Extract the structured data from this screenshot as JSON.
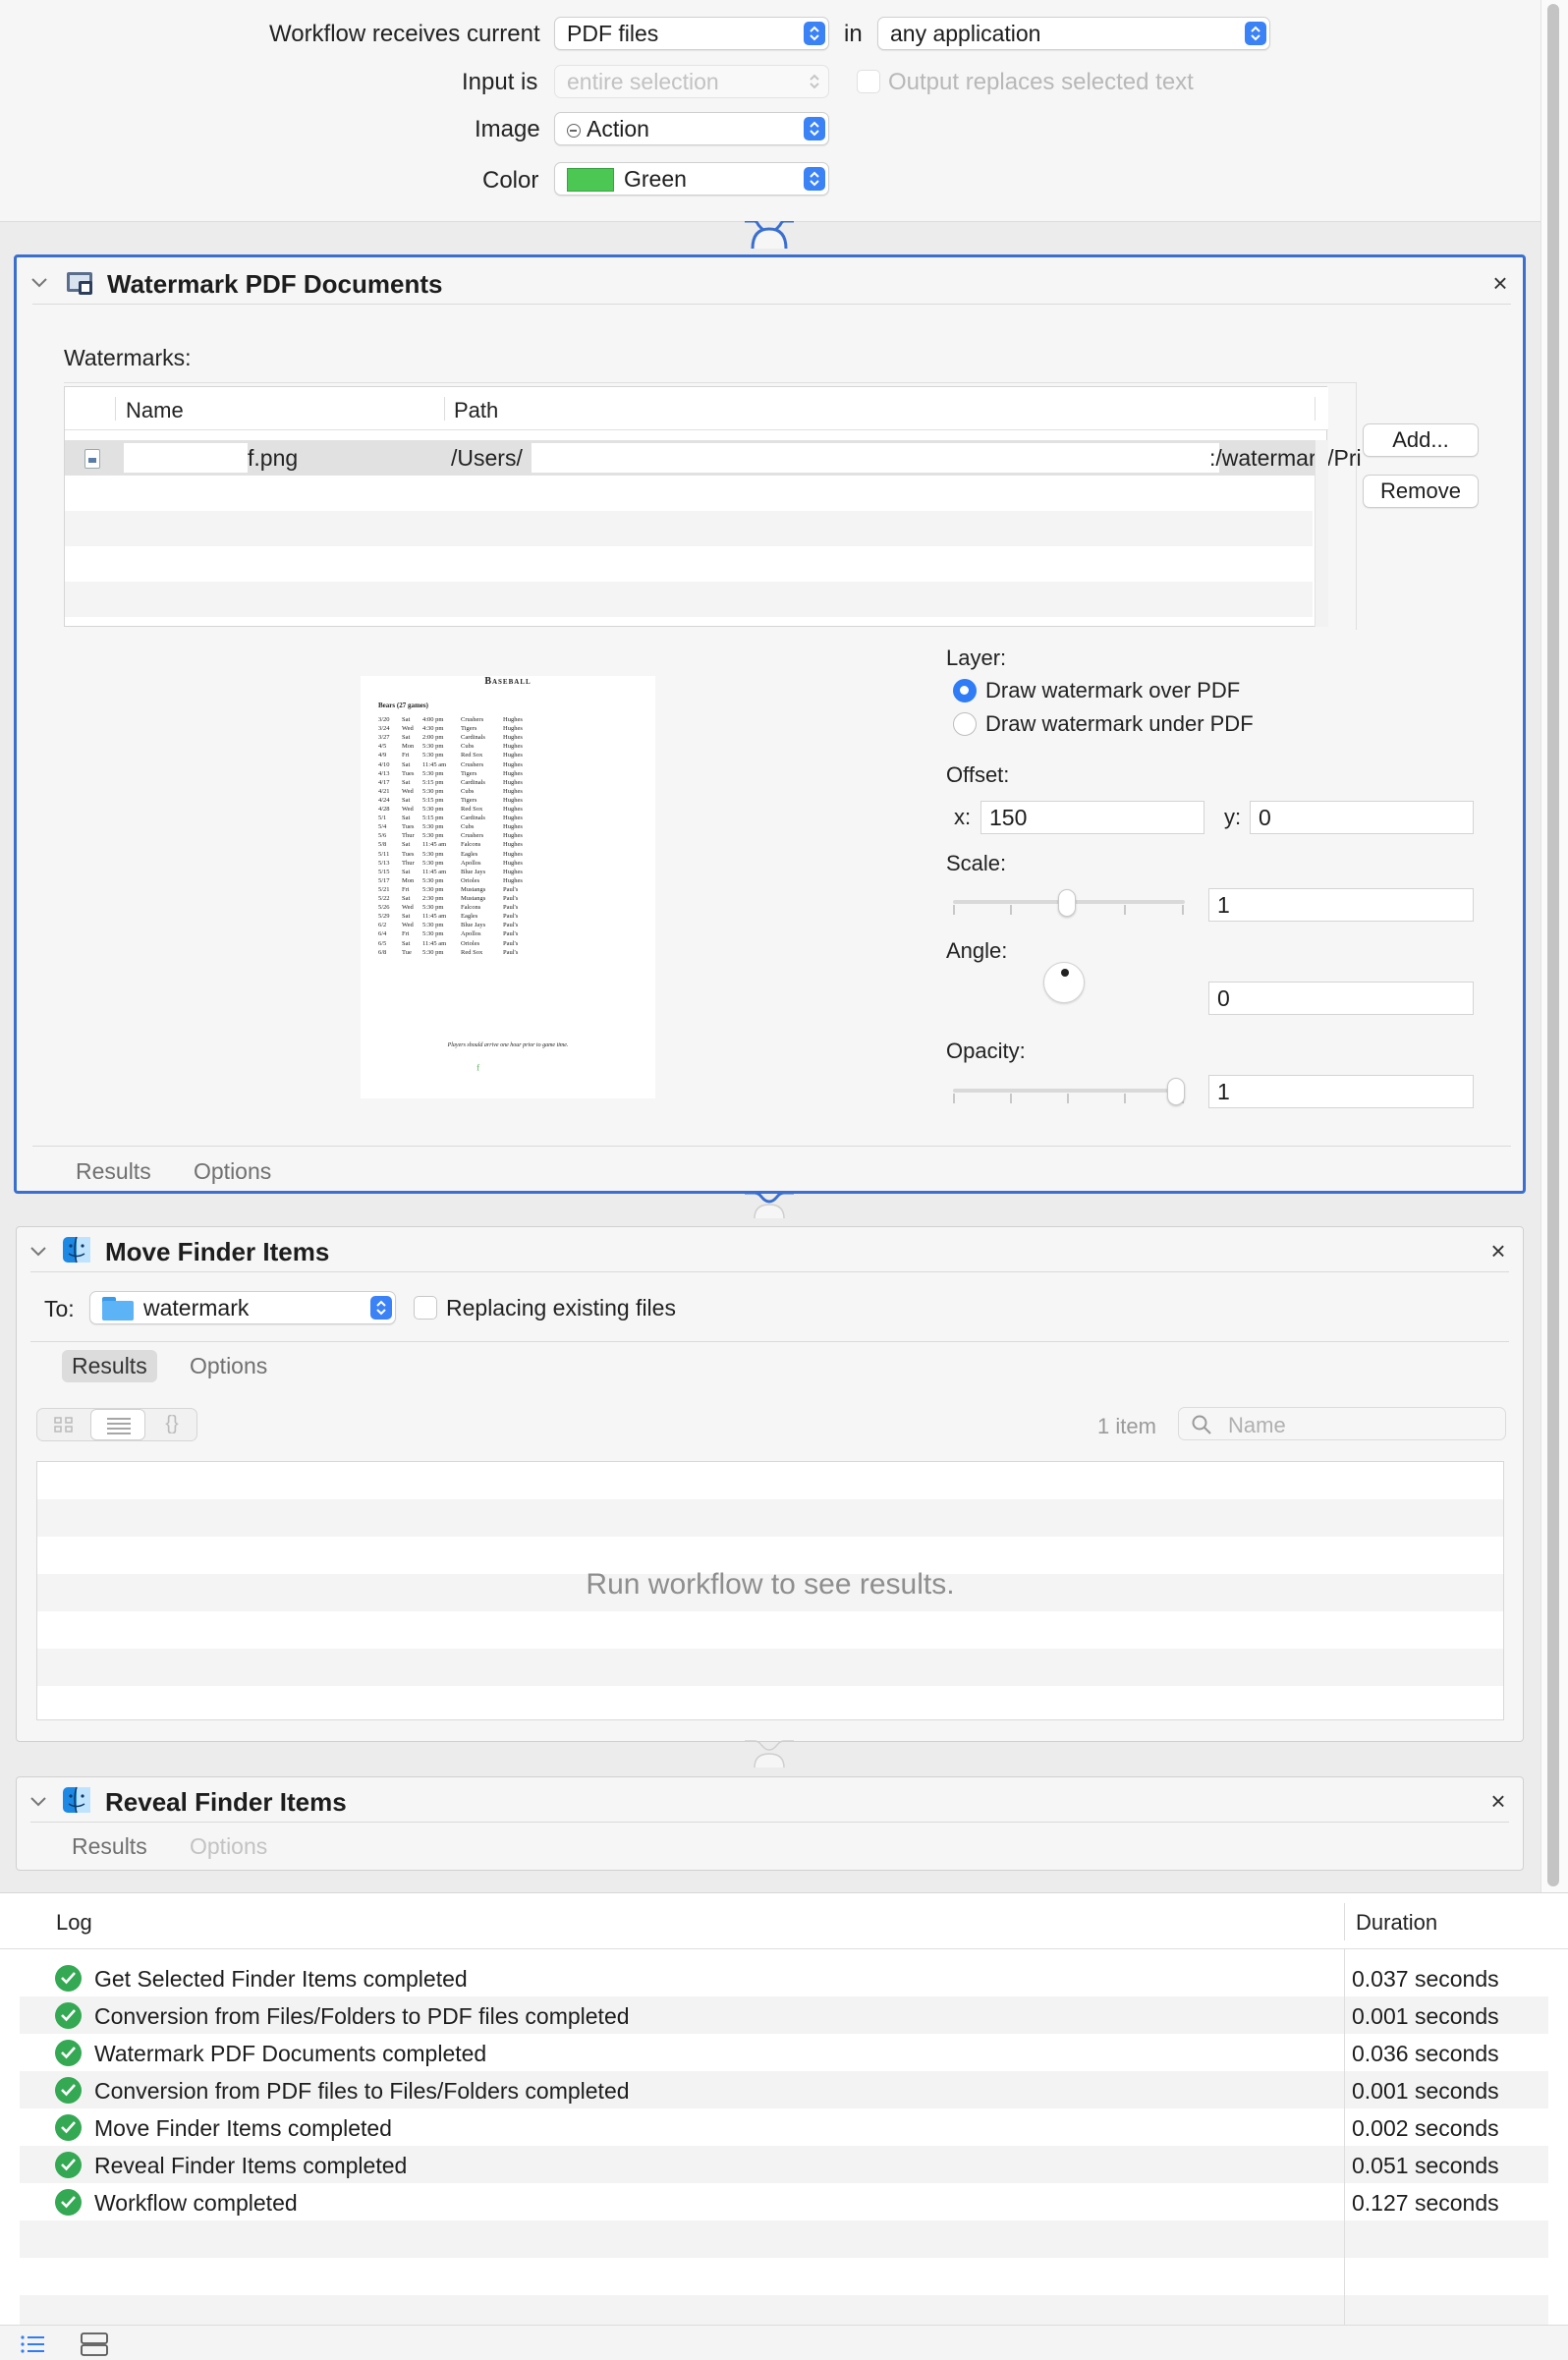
{
  "workflow": {
    "receives_label": "Workflow receives current",
    "receives_value": "PDF files",
    "in_label": "in",
    "app_value": "any application",
    "input_label": "Input is",
    "input_value": "entire selection",
    "output_replaces_label": "Output replaces selected text",
    "image_label": "Image",
    "image_value": "Action",
    "color_label": "Color",
    "color_value": "Green",
    "color_swatch": "#4cc753"
  },
  "watermark_action": {
    "title": "Watermark PDF Documents",
    "watermarks_label": "Watermarks:",
    "columns": [
      "Name",
      "Path"
    ],
    "row": {
      "name": "f.png",
      "path_start": "/Users/",
      "path_end": ":/watermark/Pri"
    },
    "add_button": "Add...",
    "remove_button": "Remove",
    "layer_label": "Layer:",
    "layer_over": "Draw watermark over PDF",
    "layer_under": "Draw watermark under PDF",
    "offset_label": "Offset:",
    "x_label": "x:",
    "x_value": "150",
    "y_label": "y:",
    "y_value": "0",
    "scale_label": "Scale:",
    "scale_value": "1",
    "angle_label": "Angle:",
    "angle_value": "0",
    "opacity_label": "Opacity:",
    "opacity_value": "1",
    "results_tab": "Results",
    "options_tab": "Options",
    "preview": {
      "title": "Baseball",
      "subtitle": "Bears (27 games)",
      "footer": "Players should arrive one hour prior to game time.",
      "games": [
        [
          "3/20",
          "Sat",
          "4:00 pm",
          "Crushers",
          "Hughes"
        ],
        [
          "3/24",
          "Wed",
          "4:30 pm",
          "Tigers",
          "Hughes"
        ],
        [
          "3/27",
          "Sat",
          "2:00 pm",
          "Cardinals",
          "Hughes"
        ],
        [
          "4/5",
          "Mon",
          "5:30 pm",
          "Cubs",
          "Hughes"
        ],
        [
          "4/9",
          "Fri",
          "5:30 pm",
          "Red Sox",
          "Hughes"
        ],
        [
          "4/10",
          "Sat",
          "11:45 am",
          "Crushers",
          "Hughes"
        ],
        [
          "4/13",
          "Tues",
          "5:30 pm",
          "Tigers",
          "Hughes"
        ],
        [
          "4/17",
          "Sat",
          "5:15 pm",
          "Cardinals",
          "Hughes"
        ],
        [
          "4/21",
          "Wed",
          "5:30 pm",
          "Cubs",
          "Hughes"
        ],
        [
          "4/24",
          "Sat",
          "5:15 pm",
          "Tigers",
          "Hughes"
        ],
        [
          "4/28",
          "Wed",
          "5:30 pm",
          "Red Sox",
          "Hughes"
        ],
        [
          "5/1",
          "Sat",
          "5:15 pm",
          "Cardinals",
          "Hughes"
        ],
        [
          "5/4",
          "Tues",
          "5:30 pm",
          "Cubs",
          "Hughes"
        ],
        [
          "5/6",
          "Thur",
          "5:30 pm",
          "Crushers",
          "Hughes"
        ],
        [
          "5/8",
          "Sat",
          "11:45 am",
          "Falcons",
          "Hughes"
        ],
        [
          "5/11",
          "Tues",
          "5:30 pm",
          "Eagles",
          "Hughes"
        ],
        [
          "5/13",
          "Thur",
          "5:30 pm",
          "Apollos",
          "Hughes"
        ],
        [
          "5/15",
          "Sat",
          "11:45 am",
          "Blue Jays",
          "Hughes"
        ],
        [
          "5/17",
          "Mon",
          "5:30 pm",
          "Orioles",
          "Hughes"
        ],
        [
          "5/21",
          "Fri",
          "5:30 pm",
          "Mustangs",
          "Paul's"
        ],
        [
          "5/22",
          "Sat",
          "2:30 pm",
          "Mustangs",
          "Paul's"
        ],
        [
          "5/26",
          "Wed",
          "5:30 pm",
          "Falcons",
          "Paul's"
        ],
        [
          "5/29",
          "Sat",
          "11:45 am",
          "Eagles",
          "Paul's"
        ],
        [
          "6/2",
          "Wed",
          "5:30 pm",
          "Blue Jays",
          "Paul's"
        ],
        [
          "6/4",
          "Fri",
          "5:30 pm",
          "Apollos",
          "Paul's"
        ],
        [
          "6/5",
          "Sat",
          "11:45 am",
          "Orioles",
          "Paul's"
        ],
        [
          "6/8",
          "Tue",
          "5:30 pm",
          "Red Sox",
          "Paul's"
        ]
      ]
    }
  },
  "move_action": {
    "title": "Move Finder Items",
    "to_label": "To:",
    "to_value": "watermark",
    "replacing_label": "Replacing existing files",
    "results_tab": "Results",
    "options_tab": "Options",
    "item_count": "1 item",
    "search_placeholder": "Name",
    "empty_message": "Run workflow to see results."
  },
  "reveal_action": {
    "title": "Reveal Finder Items",
    "results_tab": "Results",
    "options_tab": "Options"
  },
  "log": {
    "col_log": "Log",
    "col_duration": "Duration",
    "entries": [
      {
        "message": "Get Selected Finder Items completed",
        "duration": "0.037 seconds"
      },
      {
        "message": "Conversion from Files/Folders to PDF files completed",
        "duration": "0.001 seconds"
      },
      {
        "message": "Watermark PDF Documents completed",
        "duration": "0.036 seconds"
      },
      {
        "message": "Conversion from PDF files to Files/Folders completed",
        "duration": "0.001 seconds"
      },
      {
        "message": "Move Finder Items completed",
        "duration": "0.002 seconds"
      },
      {
        "message": "Reveal Finder Items completed",
        "duration": "0.051 seconds"
      },
      {
        "message": "Workflow completed",
        "duration": "0.127 seconds"
      }
    ]
  }
}
